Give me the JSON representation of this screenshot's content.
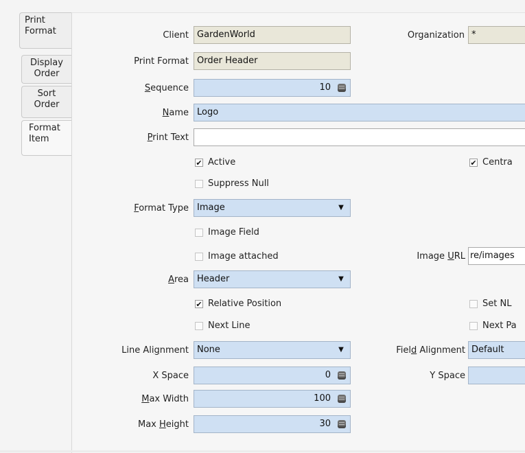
{
  "tabs": [
    {
      "label_lines": [
        "Print",
        "Format"
      ]
    },
    {
      "label_lines": [
        "Display",
        "Order"
      ]
    },
    {
      "label_lines": [
        "Sort",
        "Order"
      ]
    },
    {
      "label_lines": [
        "Format",
        "Item"
      ],
      "selected": true
    }
  ],
  "fields": {
    "client": {
      "label": "Client",
      "value": "GardenWorld"
    },
    "organization": {
      "label": "Organization",
      "value": "*"
    },
    "print_format": {
      "label": "Print Format",
      "value": "Order Header"
    },
    "sequence": {
      "label_key": "S",
      "label_rest": "equence",
      "value": "10"
    },
    "name": {
      "label_key": "N",
      "label_rest": "ame",
      "value": "Logo"
    },
    "print_text": {
      "label_key": "P",
      "label_rest": "rint Text",
      "value": ""
    },
    "format_type": {
      "label_key": "F",
      "label_rest": "ormat Type",
      "value": "Image"
    },
    "image_url": {
      "label_pre": "Image ",
      "label_key": "U",
      "label_rest": "RL",
      "value": "re/images"
    },
    "area": {
      "label_key": "A",
      "label_rest": "rea",
      "value": "Header"
    },
    "line_alignment": {
      "label_pre": "Line Ali",
      "label_key": "g",
      "label_rest": "nment",
      "value": "None"
    },
    "field_alignment": {
      "label_pre": "Fiel",
      "label_key": "d",
      "label_rest": " Alignment",
      "value": "Default"
    },
    "x_space": {
      "label": "X Space",
      "value": "0"
    },
    "y_space": {
      "label": "Y Space",
      "value": ""
    },
    "max_width": {
      "label_key": "M",
      "label_rest": "ax Width",
      "value": "100"
    },
    "max_height": {
      "label_pre": "Max ",
      "label_key": "H",
      "label_rest": "eight",
      "value": "30"
    }
  },
  "checkboxes": {
    "active": {
      "label": "Active",
      "checked": true
    },
    "central": {
      "label": "Centra",
      "checked": true
    },
    "suppress_null": {
      "label": "Suppress Null",
      "checked": false
    },
    "image_field": {
      "label": "Image Field",
      "checked": false
    },
    "image_attached": {
      "label": "Image attached",
      "checked": false
    },
    "relative_position": {
      "label": "Relative Position",
      "checked": true
    },
    "set_nl": {
      "label": "Set NL",
      "checked": false
    },
    "next_line": {
      "label": "Next Line",
      "checked": false
    },
    "next_page": {
      "label": "Next Pa",
      "checked": false
    }
  },
  "icons": {
    "dropdown": "chevron-down-icon",
    "spinner": "number-spinner-icon",
    "checkmark": "checkmark-icon"
  },
  "colors": {
    "readonly_field": "#e9e7d9",
    "mandatory_field": "#cfe0f3",
    "optional_field": "#ffffff"
  }
}
